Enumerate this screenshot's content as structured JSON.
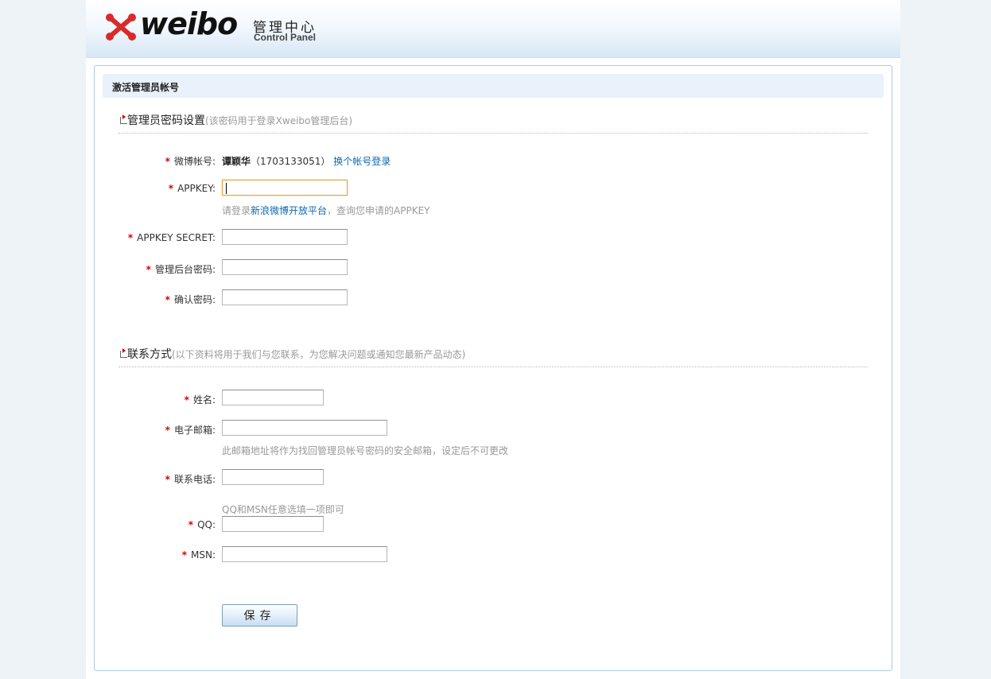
{
  "brand": {
    "wordmark": "weibo",
    "cn_title": "管理中心",
    "en_title": "Control Panel"
  },
  "panel": {
    "title": "激活管理员帐号"
  },
  "section_admin": {
    "title": "管理员密码设置",
    "note": "(该密码用于登录Xweibo管理后台)"
  },
  "section_contact": {
    "title": "联系方式",
    "note": "(以下资料将用于我们与您联系，为您解决问题或通知您最新产品动态)"
  },
  "required_mark": "*",
  "fields": {
    "weibo_account": {
      "label": "微博帐号:",
      "name": "谭颖华",
      "id": "（1703133051）",
      "switch_link": "换个帐号登录"
    },
    "appkey": {
      "label": "APPKEY:",
      "value": "",
      "hint_prefix": "请登录",
      "hint_link": "新浪微博开放平台",
      "hint_suffix": "，查询您申请的APPKEY"
    },
    "appkey_secret": {
      "label": "APPKEY SECRET:",
      "value": ""
    },
    "admin_password": {
      "label": "管理后台密码:",
      "value": ""
    },
    "confirm_password": {
      "label": "确认密码:",
      "value": ""
    },
    "name": {
      "label": "姓名:",
      "value": ""
    },
    "email": {
      "label": "电子邮箱:",
      "value": "",
      "hint": "此邮箱地址将作为找回管理员帐号密码的安全邮箱，设定后不可更改"
    },
    "phone": {
      "label": "联系电话:",
      "value": ""
    },
    "qq": {
      "label": "QQ:",
      "value": "",
      "hint": "QQ和MSN任意选填一项即可"
    },
    "msn": {
      "label": "MSN:",
      "value": ""
    }
  },
  "buttons": {
    "save": "保存"
  },
  "colors": {
    "required": "#d40000",
    "link": "#0a68b4",
    "hint": "#999999",
    "focus_border": "#e0a43d",
    "panel_border": "#a9cbe0"
  }
}
